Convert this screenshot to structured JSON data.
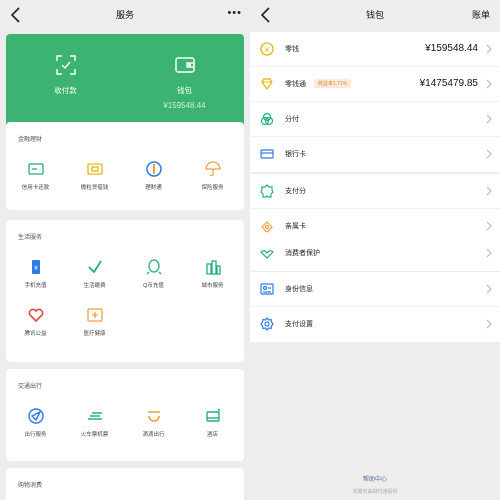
{
  "left": {
    "title": "服务",
    "more": "•••",
    "green_card": {
      "pay": {
        "label": "收付款"
      },
      "wallet": {
        "label": "钱包",
        "balance": "¥159548.44"
      }
    },
    "sections": [
      {
        "title": "金融理财",
        "items": [
          {
            "label": "信用卡还款"
          },
          {
            "label": "微粒贷借钱"
          },
          {
            "label": "理财通"
          },
          {
            "label": "保险服务"
          }
        ]
      },
      {
        "title": "生活服务",
        "items": [
          {
            "label": "手机充值"
          },
          {
            "label": "生活缴费"
          },
          {
            "label": "Q币充值"
          },
          {
            "label": "城市服务"
          },
          {
            "label": "腾讯公益"
          },
          {
            "label": "医疗健康"
          }
        ]
      },
      {
        "title": "交通出行",
        "items": [
          {
            "label": "出行服务"
          },
          {
            "label": "火车票机票"
          },
          {
            "label": "滴滴出行"
          },
          {
            "label": "酒店"
          }
        ]
      },
      {
        "title": "购物消费"
      }
    ]
  },
  "right": {
    "title": "钱包",
    "bill": "账单",
    "rows": [
      {
        "label": "零钱",
        "value": "¥159548.44"
      },
      {
        "label": "零钱通",
        "badge": "收益率1.71%",
        "value": "¥1475479.85"
      },
      {
        "label": "分付"
      },
      {
        "label": "银行卡"
      },
      {
        "label": "支付分"
      },
      {
        "label": "亲属卡"
      },
      {
        "label": "消费者保护"
      },
      {
        "label": "身份信息"
      },
      {
        "label": "支付设置"
      }
    ],
    "footer_link": "帮助中心",
    "footer_note": "本服务由财付通提供"
  },
  "colors": {
    "green": "#3cb371",
    "gold": "#e9b40c",
    "orange": "#f0a042",
    "blue": "#2d7be5",
    "red": "#e0483a",
    "teal": "#22b07d"
  }
}
